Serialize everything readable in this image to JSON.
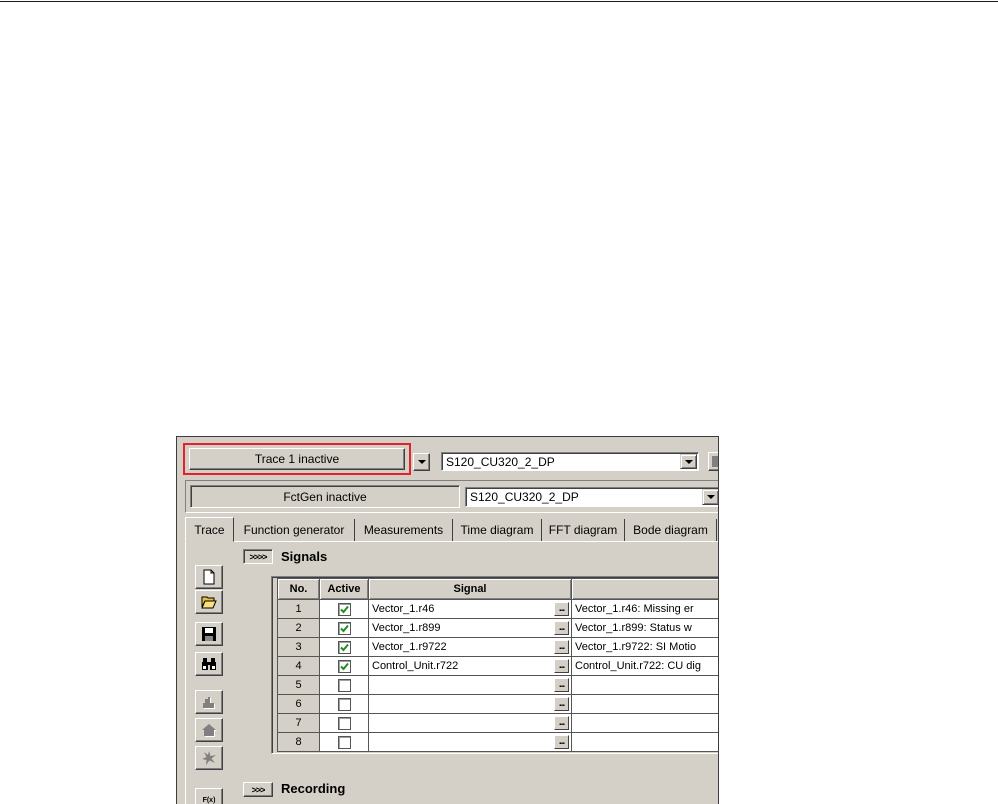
{
  "toolbar": {
    "trace_status": "Trace 1 inactive",
    "trace_device": "S120_CU320_2_DP",
    "fctgen_status": "FctGen inactive",
    "fctgen_device": "S120_CU320_2_DP"
  },
  "tabs": [
    {
      "label": "Trace",
      "selected": true
    },
    {
      "label": "Function generator",
      "selected": false
    },
    {
      "label": "Measurements",
      "selected": false
    },
    {
      "label": "Time diagram",
      "selected": false
    },
    {
      "label": "FFT diagram",
      "selected": false
    },
    {
      "label": "Bode diagram",
      "selected": false
    }
  ],
  "side_toolbar": {
    "icons": [
      "new-document-icon",
      "open-folder-icon",
      "floppy-disk-icon",
      "binoculars-icon",
      "upload-icon",
      "house-icon",
      "starburst-icon",
      "function-icon"
    ],
    "function_label": "F(x)"
  },
  "signals": {
    "toggle_label": ">>>>",
    "title": "Signals",
    "browse_label": "...",
    "columns": {
      "no": "No.",
      "active": "Active",
      "signal": "Signal",
      "description": ""
    },
    "rows": [
      {
        "no": "1",
        "active": true,
        "signal": "Vector_1.r46",
        "description": "Vector_1.r46: Missing er"
      },
      {
        "no": "2",
        "active": true,
        "signal": "Vector_1.r899",
        "description": "Vector_1.r899: Status w"
      },
      {
        "no": "3",
        "active": true,
        "signal": "Vector_1.r9722",
        "description": "Vector_1.r9722: SI Motio"
      },
      {
        "no": "4",
        "active": true,
        "signal": "Control_Unit.r722",
        "description": "Control_Unit.r722: CU dig"
      },
      {
        "no": "5",
        "active": false,
        "signal": "",
        "description": ""
      },
      {
        "no": "6",
        "active": false,
        "signal": "",
        "description": ""
      },
      {
        "no": "7",
        "active": false,
        "signal": "",
        "description": ""
      },
      {
        "no": "8",
        "active": false,
        "signal": "",
        "description": ""
      }
    ]
  },
  "recording": {
    "toggle_label": ">>>",
    "title": "Recording"
  },
  "colors": {
    "panel": "#d4d0c8",
    "highlight": "#e3232b",
    "checkmark": "#1f8f1f"
  }
}
